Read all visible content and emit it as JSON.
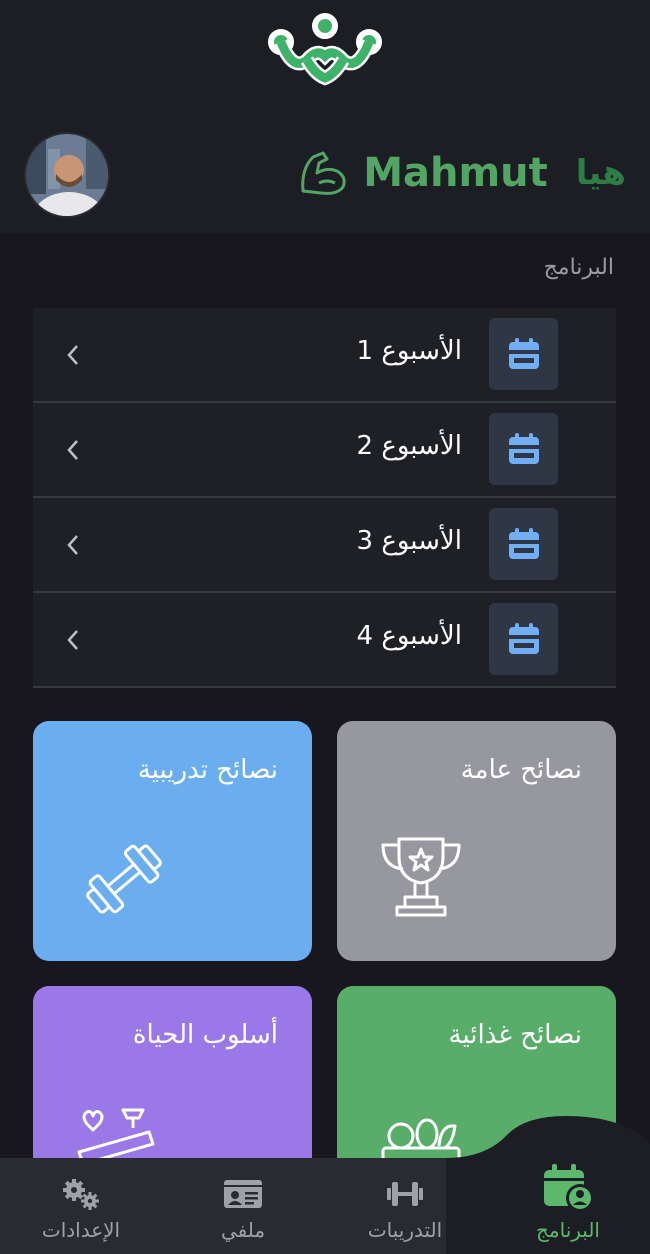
{
  "header": {
    "greeting": "هيا",
    "user_name": "Mahmut"
  },
  "program": {
    "section_label": "البرنامج",
    "weeks": [
      {
        "label": "الأسبوع 1"
      },
      {
        "label": "الأسبوع 2"
      },
      {
        "label": "الأسبوع 3"
      },
      {
        "label": "الأسبوع 4"
      }
    ]
  },
  "cards": [
    {
      "title": "نصائح تدريبية",
      "icon": "dumbbell-icon",
      "color": "#6aaef0"
    },
    {
      "title": "نصائح عامة",
      "icon": "trophy-icon",
      "color": "#97979f"
    },
    {
      "title": "أسلوب الحياة",
      "icon": "lifestyle-icon",
      "color": "#9b78e8"
    },
    {
      "title": "نصائح غذائية",
      "icon": "food-basket-icon",
      "color": "#58ad68"
    }
  ],
  "nav": {
    "items": [
      {
        "label": "البرنامج",
        "icon": "calendar-user-icon",
        "active": true
      },
      {
        "label": "التدريبات",
        "icon": "dumbbell-icon",
        "active": false
      },
      {
        "label": "ملفي",
        "icon": "id-card-icon",
        "active": false
      },
      {
        "label": "الإعدادات",
        "icon": "gears-icon",
        "active": false
      }
    ]
  },
  "colors": {
    "accent": "#58ad68",
    "calendar_tile": "#2f3644",
    "calendar_icon": "#72aef5"
  }
}
